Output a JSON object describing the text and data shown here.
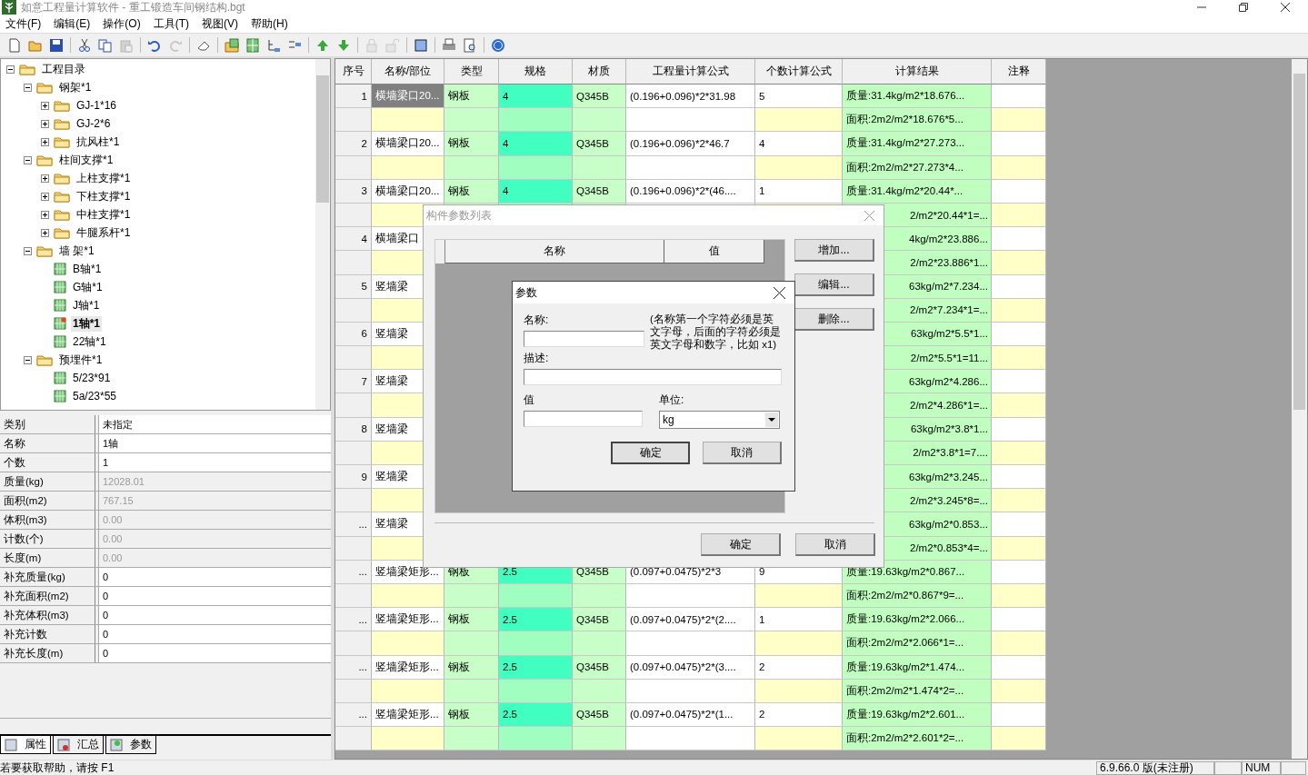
{
  "window": {
    "title": "如意工程量计算软件 - 重工锻造车间钢结构.bgt"
  },
  "menu": [
    "文件(F)",
    "编辑(E)",
    "操作(O)",
    "工具(T)",
    "视图(V)",
    "帮助(H)"
  ],
  "toolbar": [
    {
      "kind": "new",
      "disabled": false
    },
    {
      "kind": "open",
      "disabled": false
    },
    {
      "kind": "save",
      "disabled": false
    },
    {
      "kind": "sep"
    },
    {
      "kind": "cut",
      "disabled": false
    },
    {
      "kind": "copy",
      "disabled": false
    },
    {
      "kind": "paste",
      "disabled": true
    },
    {
      "kind": "sep"
    },
    {
      "kind": "undo",
      "disabled": false
    },
    {
      "kind": "redo",
      "disabled": true
    },
    {
      "kind": "sep"
    },
    {
      "kind": "eraser",
      "disabled": false
    },
    {
      "kind": "sep"
    },
    {
      "kind": "folder-grid",
      "disabled": false
    },
    {
      "kind": "grid",
      "disabled": false
    },
    {
      "kind": "indent",
      "disabled": false
    },
    {
      "kind": "outdent",
      "disabled": false
    },
    {
      "kind": "sep"
    },
    {
      "kind": "up",
      "disabled": false
    },
    {
      "kind": "down",
      "disabled": false
    },
    {
      "kind": "sep"
    },
    {
      "kind": "lock",
      "disabled": true
    },
    {
      "kind": "unlock",
      "disabled": true
    },
    {
      "kind": "sep"
    },
    {
      "kind": "frame",
      "disabled": false
    },
    {
      "kind": "sep"
    },
    {
      "kind": "print",
      "disabled": false
    },
    {
      "kind": "preview",
      "disabled": false
    },
    {
      "kind": "sep"
    },
    {
      "kind": "help",
      "disabled": false
    }
  ],
  "tree": [
    {
      "label": "工程目录",
      "kind": "folder",
      "expanded": true,
      "selected": false,
      "children": [
        {
          "label": "钢架*1",
          "kind": "folder",
          "expanded": true,
          "selected": false,
          "children": [
            {
              "label": "GJ-1*16",
              "kind": "folder",
              "expanded": false,
              "selected": false
            },
            {
              "label": "GJ-2*6",
              "kind": "folder",
              "expanded": false,
              "selected": false
            },
            {
              "label": "抗风柱*1",
              "kind": "folder",
              "expanded": false,
              "selected": false
            }
          ]
        },
        {
          "label": "柱间支撑*1",
          "kind": "folder",
          "expanded": true,
          "selected": false,
          "children": [
            {
              "label": "上柱支撑*1",
              "kind": "folder",
              "expanded": false,
              "selected": false
            },
            {
              "label": "下柱支撑*1",
              "kind": "folder",
              "expanded": false,
              "selected": false
            },
            {
              "label": "中柱支撑*1",
              "kind": "folder",
              "expanded": false,
              "selected": false
            },
            {
              "label": "牛腿系杆*1",
              "kind": "folder",
              "expanded": false,
              "selected": false
            }
          ]
        },
        {
          "label": "墙 架*1",
          "kind": "folder",
          "expanded": true,
          "selected": false,
          "children": [
            {
              "label": "B轴*1",
              "kind": "component",
              "selected": false
            },
            {
              "label": "G轴*1",
              "kind": "component",
              "selected": false
            },
            {
              "label": "J轴*1",
              "kind": "component",
              "selected": false
            },
            {
              "label": "1轴*1",
              "kind": "component",
              "selected": true
            },
            {
              "label": "22轴*1",
              "kind": "component",
              "selected": false
            }
          ]
        },
        {
          "label": "预埋件*1",
          "kind": "folder",
          "expanded": true,
          "selected": false,
          "children": [
            {
              "label": "5/23*91",
              "kind": "component",
              "selected": false
            },
            {
              "label": "5a/23*55",
              "kind": "component",
              "selected": false
            }
          ]
        }
      ]
    }
  ],
  "properties": [
    {
      "label": "类别",
      "value": "未指定",
      "readonly": false
    },
    {
      "label": "名称",
      "value": "1轴",
      "readonly": false
    },
    {
      "label": "个数",
      "value": "1",
      "readonly": false
    },
    {
      "label": "质量(kg)",
      "value": "12028.01",
      "readonly": true
    },
    {
      "label": "面积(m2)",
      "value": "767.15",
      "readonly": true
    },
    {
      "label": "体积(m3)",
      "value": "0.00",
      "readonly": true
    },
    {
      "label": "计数(个)",
      "value": "0.00",
      "readonly": true
    },
    {
      "label": "长度(m)",
      "value": "0.00",
      "readonly": true
    },
    {
      "label": "补充质量(kg)",
      "value": "0",
      "readonly": false
    },
    {
      "label": "补充面积(m2)",
      "value": "0",
      "readonly": false
    },
    {
      "label": "补充体积(m3)",
      "value": "0",
      "readonly": false
    },
    {
      "label": "补充计数",
      "value": "0",
      "readonly": false
    },
    {
      "label": "补充长度(m)",
      "value": "0",
      "readonly": false
    }
  ],
  "panel_tabs": [
    {
      "label": "属性",
      "selected": true
    },
    {
      "label": "汇总",
      "selected": false
    },
    {
      "label": "参数",
      "selected": false
    }
  ],
  "table": {
    "columns": [
      "序号",
      "名称/部位",
      "类型",
      "规格",
      "材质",
      "工程量计算公式",
      "个数计算公式",
      "计算结果",
      "注释"
    ],
    "rows": [
      {
        "seq": "1",
        "name": "横墙梁口20...",
        "type": "钢板",
        "spec": "4",
        "material": "Q345B",
        "qty_formula": "(0.196+0.096)*2*31.98",
        "count_formula": "5",
        "mass_result": "质量:31.4kg/m2*18.676...",
        "area_result": "面积:2m2/m2*18.676*5...",
        "selected": true
      },
      {
        "seq": "2",
        "name": "横墙梁口20...",
        "type": "钢板",
        "spec": "4",
        "material": "Q345B",
        "qty_formula": "(0.196+0.096)*2*46.7",
        "count_formula": "4",
        "mass_result": "质量:31.4kg/m2*27.273...",
        "area_result": "面积:2m2/m2*27.273*4...",
        "selected": false
      },
      {
        "seq": "3",
        "name": "横墙梁口20...",
        "type": "钢板",
        "spec": "4",
        "material": "Q345B",
        "qty_formula": "(0.196+0.096)*2*(46....",
        "count_formula": "1",
        "mass_result": "质量:31.4kg/m2*20.44*...",
        "area_result": "2/m2*20.44*1=...",
        "selected": false
      },
      {
        "seq": "4",
        "name": "横墙梁口",
        "mass_result": "4kg/m2*23.886...",
        "area_result": "2/m2*23.886*1...",
        "selected": false
      },
      {
        "seq": "5",
        "name": "竖墙梁",
        "mass_result": "63kg/m2*7.234...",
        "area_result": "2/m2*7.234*1=...",
        "selected": false
      },
      {
        "seq": "6",
        "name": "竖墙梁",
        "mass_result": "63kg/m2*5.5*1...",
        "area_result": "2/m2*5.5*1=11...",
        "selected": false
      },
      {
        "seq": "7",
        "name": "竖墙梁",
        "mass_result": "63kg/m2*4.286...",
        "area_result": "2/m2*4.286*1=...",
        "selected": false
      },
      {
        "seq": "8",
        "name": "竖墙梁",
        "mass_result": "63kg/m2*3.8*1...",
        "area_result": "2/m2*3.8*1=7....",
        "selected": false
      },
      {
        "seq": "9",
        "name": "竖墙梁",
        "mass_result": "63kg/m2*3.245...",
        "area_result": "2/m2*3.245*8=...",
        "selected": false
      },
      {
        "seq": "...",
        "name": "竖墙梁",
        "mass_result": "63kg/m2*0.853...",
        "area_result": "2/m2*0.853*4=...",
        "selected": false
      },
      {
        "seq": "...",
        "name": "竖墙梁矩形...",
        "type": "钢板",
        "spec": "2.5",
        "material": "Q345B",
        "qty_formula": "(0.097+0.0475)*2*3",
        "count_formula": "9",
        "mass_result": "质量:19.63kg/m2*0.867...",
        "area_result": "面积:2m2/m2*0.867*9=...",
        "selected": false
      },
      {
        "seq": "...",
        "name": "竖墙梁矩形...",
        "type": "钢板",
        "spec": "2.5",
        "material": "Q345B",
        "qty_formula": "(0.097+0.0475)*2*(2....",
        "count_formula": "1",
        "mass_result": "质量:19.63kg/m2*2.066...",
        "area_result": "面积:2m2/m2*2.066*1=...",
        "selected": false
      },
      {
        "seq": "...",
        "name": "竖墙梁矩形...",
        "type": "钢板",
        "spec": "2.5",
        "material": "Q345B",
        "qty_formula": "(0.097+0.0475)*2*(3....",
        "count_formula": "2",
        "mass_result": "质量:19.63kg/m2*1.474...",
        "area_result": "面积:2m2/m2*1.474*2=...",
        "selected": false
      },
      {
        "seq": "...",
        "name": "竖墙梁矩形...",
        "type": "钢板",
        "spec": "2.5",
        "material": "Q345B",
        "qty_formula": "(0.097+0.0475)*2*(1...",
        "count_formula": "2",
        "mass_result": "质量:19.63kg/m2*2.601...",
        "area_result": "面积:2m2/m2*2.601*2=...",
        "selected": false
      }
    ]
  },
  "param_list_dialog": {
    "title": "构件参数列表",
    "columns": [
      "名称",
      "值"
    ],
    "side_buttons": [
      "增加...",
      "编辑...",
      "删除..."
    ],
    "buttons": [
      "确定",
      "取消"
    ]
  },
  "param_dialog": {
    "title": "参数",
    "name_label": "名称:",
    "hint": "(名称第一个字符必须是英文字母，后面的字符必须是英文字母和数字，比如 x1)",
    "desc_label": "描述:",
    "value_label": "值",
    "unit_label": "单位:",
    "unit": "kg",
    "buttons": [
      "确定",
      "取消"
    ]
  },
  "status_bar": {
    "help": "若要获取帮助，请按 F1",
    "version": "6.9.66.0 版(未注册)",
    "num": "NUM"
  }
}
